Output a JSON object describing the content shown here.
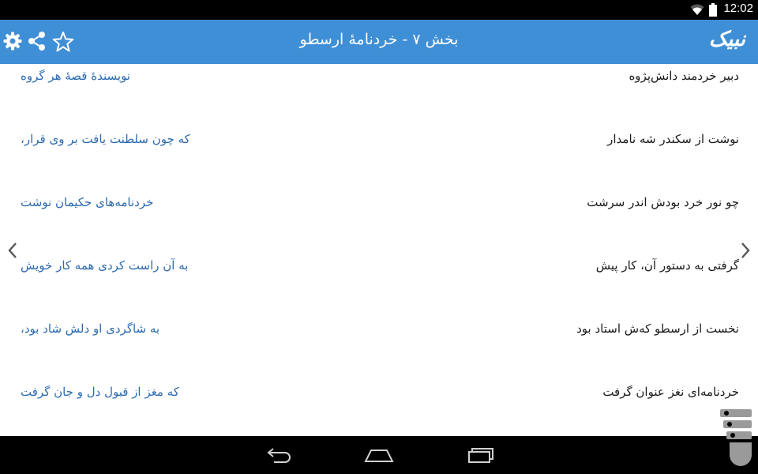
{
  "status_bar": {
    "time": "12:02",
    "icons": [
      "wifi-icon",
      "battery-icon"
    ]
  },
  "app_bar": {
    "title": "بخش ۷ - خردنامهٔ ارسطو",
    "logo_text": "نبیک",
    "actions": [
      "settings-icon",
      "share-icon",
      "star-icon"
    ],
    "color": "#3f8fd6"
  },
  "poem": {
    "verses": [
      {
        "right": "دبیر خردمند دانش‌پژوه",
        "left": "نویسندهٔ قصهٔ هر گروه"
      },
      {
        "right": "نوشت از سکندر شه نامدار",
        "left": "که چون سلطنت یافت بر وی قرار،"
      },
      {
        "right": "چو نور خرد بودش اندر سرشت",
        "left": "خردنامه‌های حکیمان نوشت"
      },
      {
        "right": "گرفتی به دستور آن، کار پیش",
        "left": "به آن راست کردی همه کار خویش"
      },
      {
        "right": "نخست از ارسطو که‌ش استاد بود",
        "left": "به شاگردی او دلش شاد بود،"
      },
      {
        "right": "خردنامه‌ای نغز عنوان گرفت",
        "left": "که مغز از قبول دل و جان گرفت"
      }
    ],
    "first_hemistich_color": "#1a1a1a",
    "second_hemistich_color": "#2c6ab0"
  },
  "navigation": {
    "prev_icon": "chevron-left-icon",
    "next_icon": "chevron-right-icon"
  },
  "system_nav": {
    "buttons": [
      "back-icon",
      "home-icon",
      "recent-apps-icon"
    ]
  }
}
